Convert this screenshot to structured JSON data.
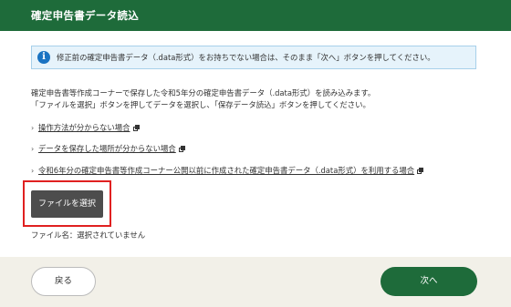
{
  "header": {
    "title": "確定申告書データ読込"
  },
  "info": {
    "icon": "info-icon",
    "glyph": "i",
    "text": "修正前の確定申告書データ（.data形式）をお持ちでない場合は、そのまま「次へ」ボタンを押してください。"
  },
  "description": {
    "line1": "確定申告書等作成コーナーで保存した令和5年分の確定申告書データ（.data形式）を読み込みます。",
    "line2": "「ファイルを選択」ボタンを押してデータを選択し、「保存データ読込」ボタンを押してください。"
  },
  "links": [
    {
      "chevron": "›",
      "label": "操作方法が分からない場合",
      "icon": "external-window-icon"
    },
    {
      "chevron": "›",
      "label": "データを保存した場所が分からない場合",
      "icon": "external-window-icon"
    },
    {
      "chevron": "›",
      "label": "令和6年分の確定申告書等作成コーナー公開以前に作成された確定申告書データ（.data形式）を利用する場合",
      "icon": "external-window-icon"
    }
  ],
  "file": {
    "button_label": "ファイルを選択",
    "file_name_text": "ファイル名：選択されていません"
  },
  "footer": {
    "back_label": "戻る",
    "next_label": "次へ"
  },
  "colors": {
    "header_bg": "#1e6b3a",
    "info_bg": "#e6f3fb",
    "info_icon": "#1a73c2",
    "file_button_bg": "#4d4d4d",
    "highlight_border": "#e02020",
    "footer_bg": "#f2f0e8",
    "next_button_bg": "#1e6b3a"
  }
}
